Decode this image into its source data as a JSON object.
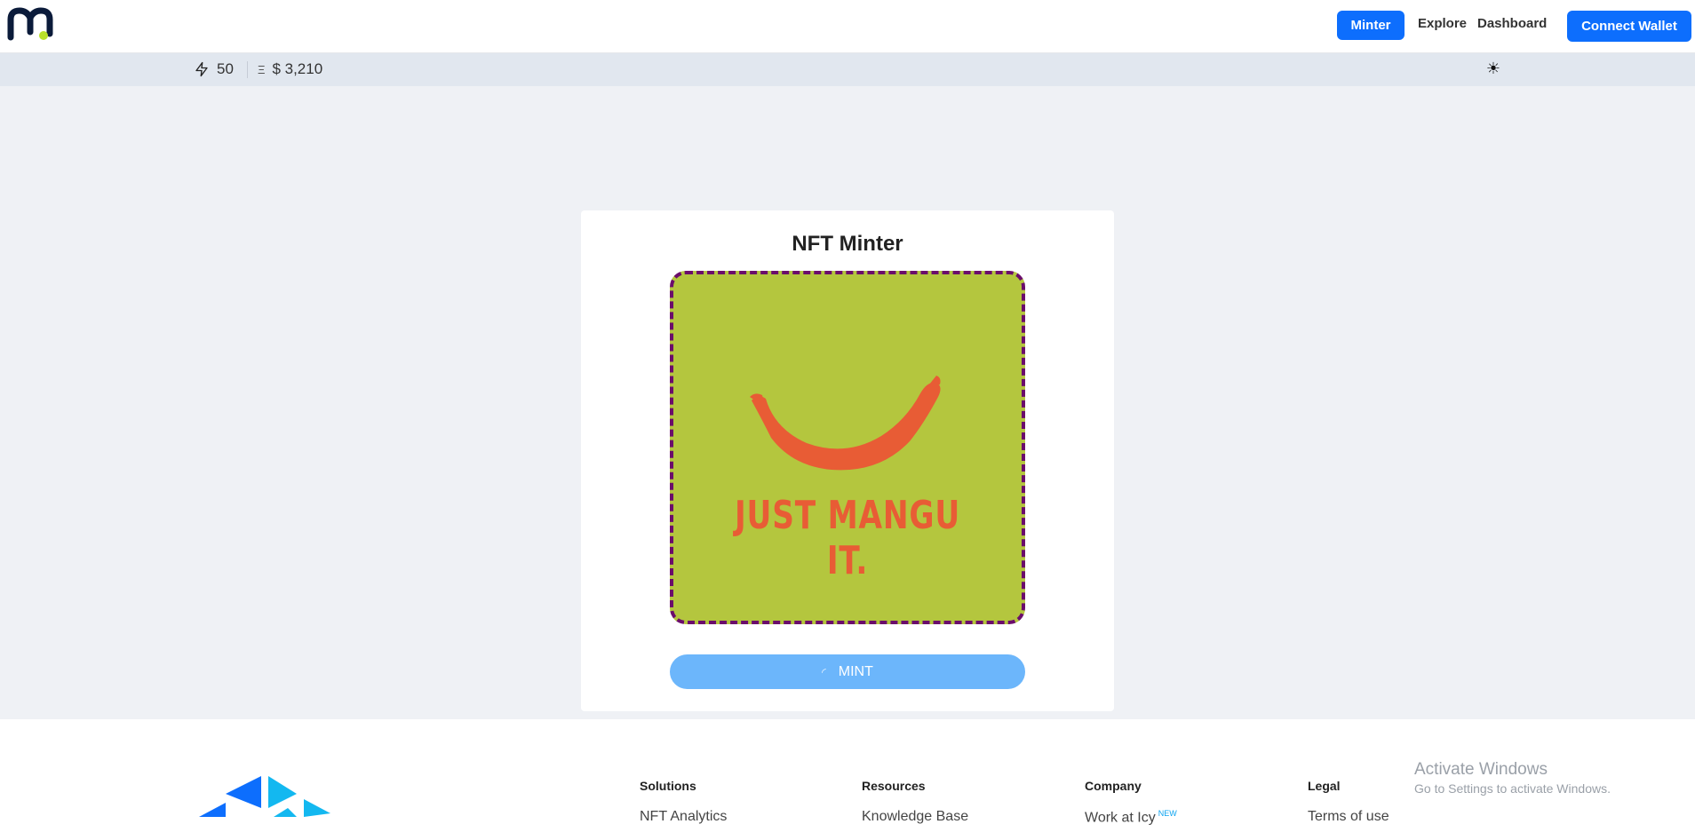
{
  "header": {
    "nav": {
      "minter": "Minter",
      "explore": "Explore",
      "dashboard": "Dashboard"
    },
    "connect_wallet": "Connect Wallet"
  },
  "stats": {
    "gas": "50",
    "eth_symbol": "Ξ",
    "eth_price": "$ 3,210"
  },
  "card": {
    "title": "NFT Minter",
    "nft_slogan": "JUST MANGU IT.",
    "mint_label": "MINT",
    "colors": {
      "nft_background": "#b4c63e",
      "nft_border": "#6b0d6b",
      "banana": "#e85c35",
      "mint_button": "#6cb6fb"
    }
  },
  "footer": {
    "columns": [
      {
        "title": "Solutions",
        "link": "NFT Analytics"
      },
      {
        "title": "Resources",
        "link": "Knowledge Base"
      },
      {
        "title": "Company",
        "link": "Work at Icy",
        "badge": "NEW"
      },
      {
        "title": "Legal",
        "link": "Terms of use"
      }
    ]
  },
  "os_watermark": {
    "title": "Activate Windows",
    "subtitle": "Go to Settings to activate Windows."
  },
  "icons": {
    "logo": "m-logo-icon",
    "gas": "lightning-icon",
    "theme": "sun-icon",
    "spinner": "spinner-icon",
    "footer_logo": "icy-logo-icon"
  },
  "colors": {
    "primary": "#0d6efd",
    "background": "#eff1f5",
    "statsbar": "#e1e7ef"
  }
}
